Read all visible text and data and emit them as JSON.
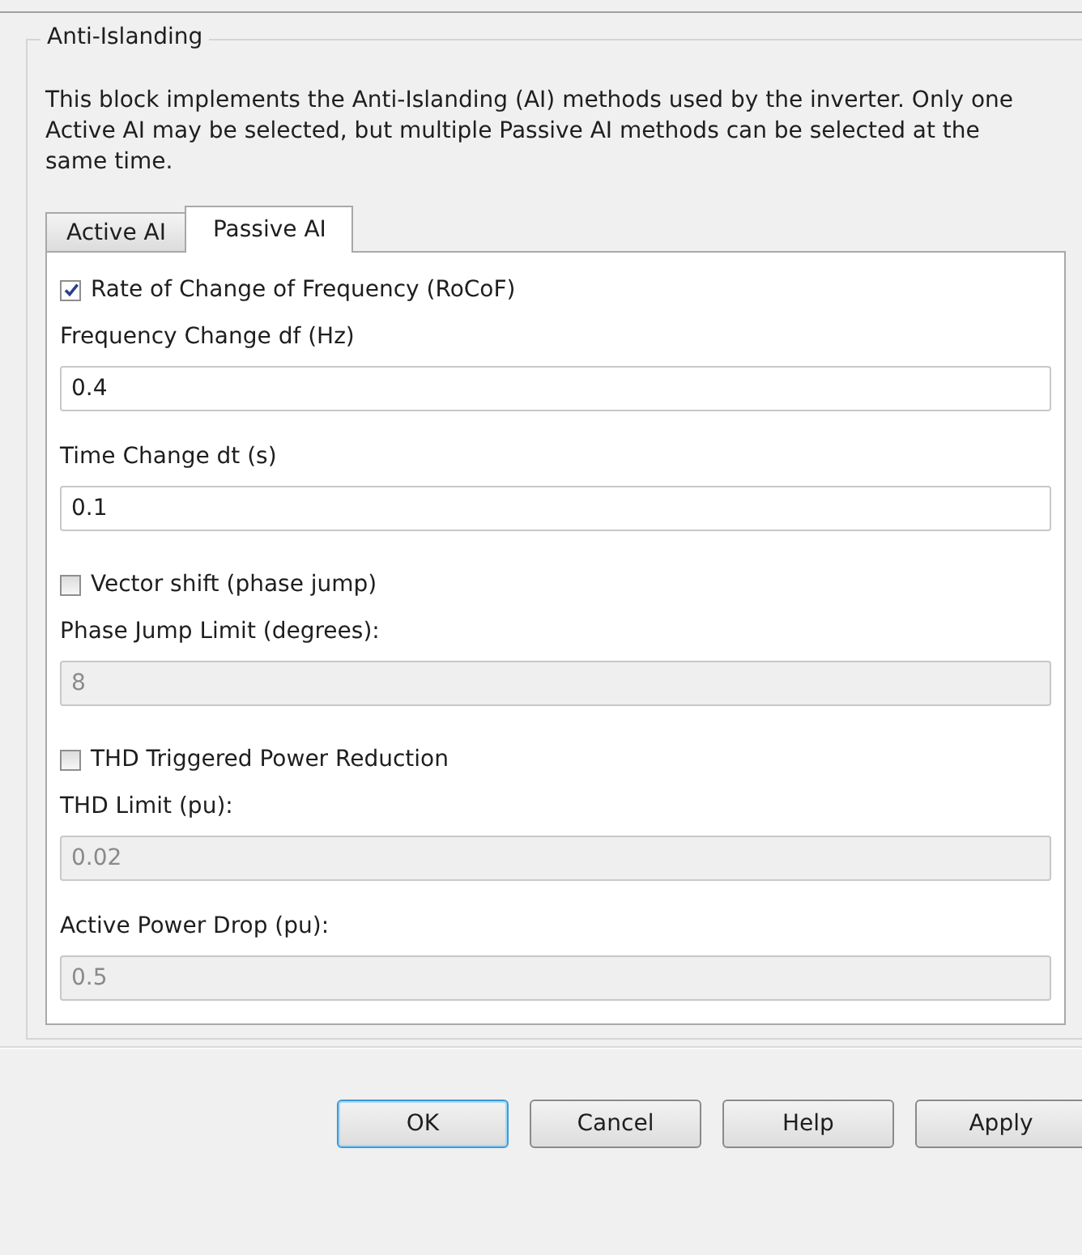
{
  "group": {
    "title": "Anti-Islanding"
  },
  "description": "This block implements the Anti-Islanding (AI) methods used by the inverter. Only one Active AI may be selected, but multiple Passive AI methods can be selected at the same time.",
  "tabs": [
    {
      "label": "Active AI",
      "selected": false
    },
    {
      "label": "Passive AI",
      "selected": true
    }
  ],
  "items": [
    {
      "kind": "checkbox",
      "label": "Rate of Change of Frequency (RoCoF)",
      "checked": true
    },
    {
      "kind": "field",
      "label": "Frequency Change df (Hz)",
      "value": "0.4",
      "disabled": false
    },
    {
      "kind": "field",
      "label": "Time Change dt (s)",
      "value": "0.1",
      "disabled": false
    },
    {
      "kind": "checkbox",
      "label": "Vector shift (phase jump)",
      "checked": false
    },
    {
      "kind": "field",
      "label": "Phase Jump Limit (degrees):",
      "value": "8",
      "disabled": true
    },
    {
      "kind": "checkbox",
      "label": "THD Triggered Power Reduction",
      "checked": false
    },
    {
      "kind": "field",
      "label": "THD Limit (pu):",
      "value": "0.02",
      "disabled": true
    },
    {
      "kind": "field",
      "label": "Active Power Drop (pu):",
      "value": "0.5",
      "disabled": true
    }
  ],
  "buttons": [
    {
      "label": "OK",
      "default": true
    },
    {
      "label": "Cancel",
      "default": false
    },
    {
      "label": "Help",
      "default": false
    },
    {
      "label": "Apply",
      "default": false
    }
  ]
}
